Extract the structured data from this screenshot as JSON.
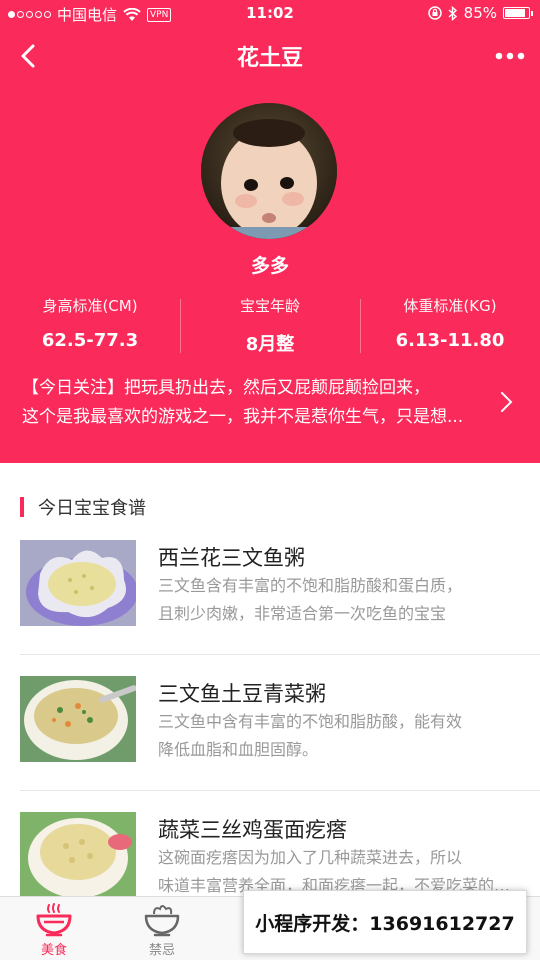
{
  "status_bar": {
    "carrier": "中国电信",
    "vpn": "VPN",
    "time": "11:02",
    "battery": "85%",
    "battery_level": 0.85
  },
  "nav": {
    "title": "花土豆"
  },
  "profile": {
    "name": "多多",
    "stats": [
      {
        "label": "身高标准(CM)",
        "value": "62.5-77.3"
      },
      {
        "label": "宝宝年龄",
        "value": "8月整"
      },
      {
        "label": "体重标准(KG)",
        "value": "6.13-11.80"
      }
    ],
    "notice_line1": "【今日关注】把玩具扔出去，然后又屁颠屁颠捡回来，",
    "notice_line2": "这个是我最喜欢的游戏之一，我并不是惹你生气，只是想..."
  },
  "section": {
    "title": "今日宝宝食谱"
  },
  "recipes": [
    {
      "title": "西兰花三文鱼粥",
      "desc_line1": "三文鱼含有丰富的不饱和脂肪酸和蛋白质，",
      "desc_line2": "且刺少肉嫩，非常适合第一次吃鱼的宝宝"
    },
    {
      "title": "三文鱼土豆青菜粥",
      "desc_line1": "三文鱼中含有丰富的不饱和脂肪酸，能有效",
      "desc_line2": "降低血脂和血胆固醇。"
    },
    {
      "title": "蔬菜三丝鸡蛋面疙瘩",
      "desc_line1": "这碗面疙瘩因为加入了几种蔬菜进去，所以",
      "desc_line2": "味道丰富营养全面，和面疙瘩一起，不爱吃菜的宝宝也能吃"
    }
  ],
  "tabbar": {
    "tabs": [
      {
        "label": "美食",
        "icon": "bowl-icon"
      },
      {
        "label": "禁忌",
        "icon": "salad-bowl-icon"
      },
      {
        "label": "",
        "icon": "tab-icon"
      },
      {
        "label": "",
        "icon": "tab-icon"
      },
      {
        "label": "",
        "icon": "tab-icon"
      }
    ]
  },
  "watermark": {
    "text": "小程序开发：13691612727"
  },
  "colors": {
    "accent": "#fa2b5a"
  }
}
